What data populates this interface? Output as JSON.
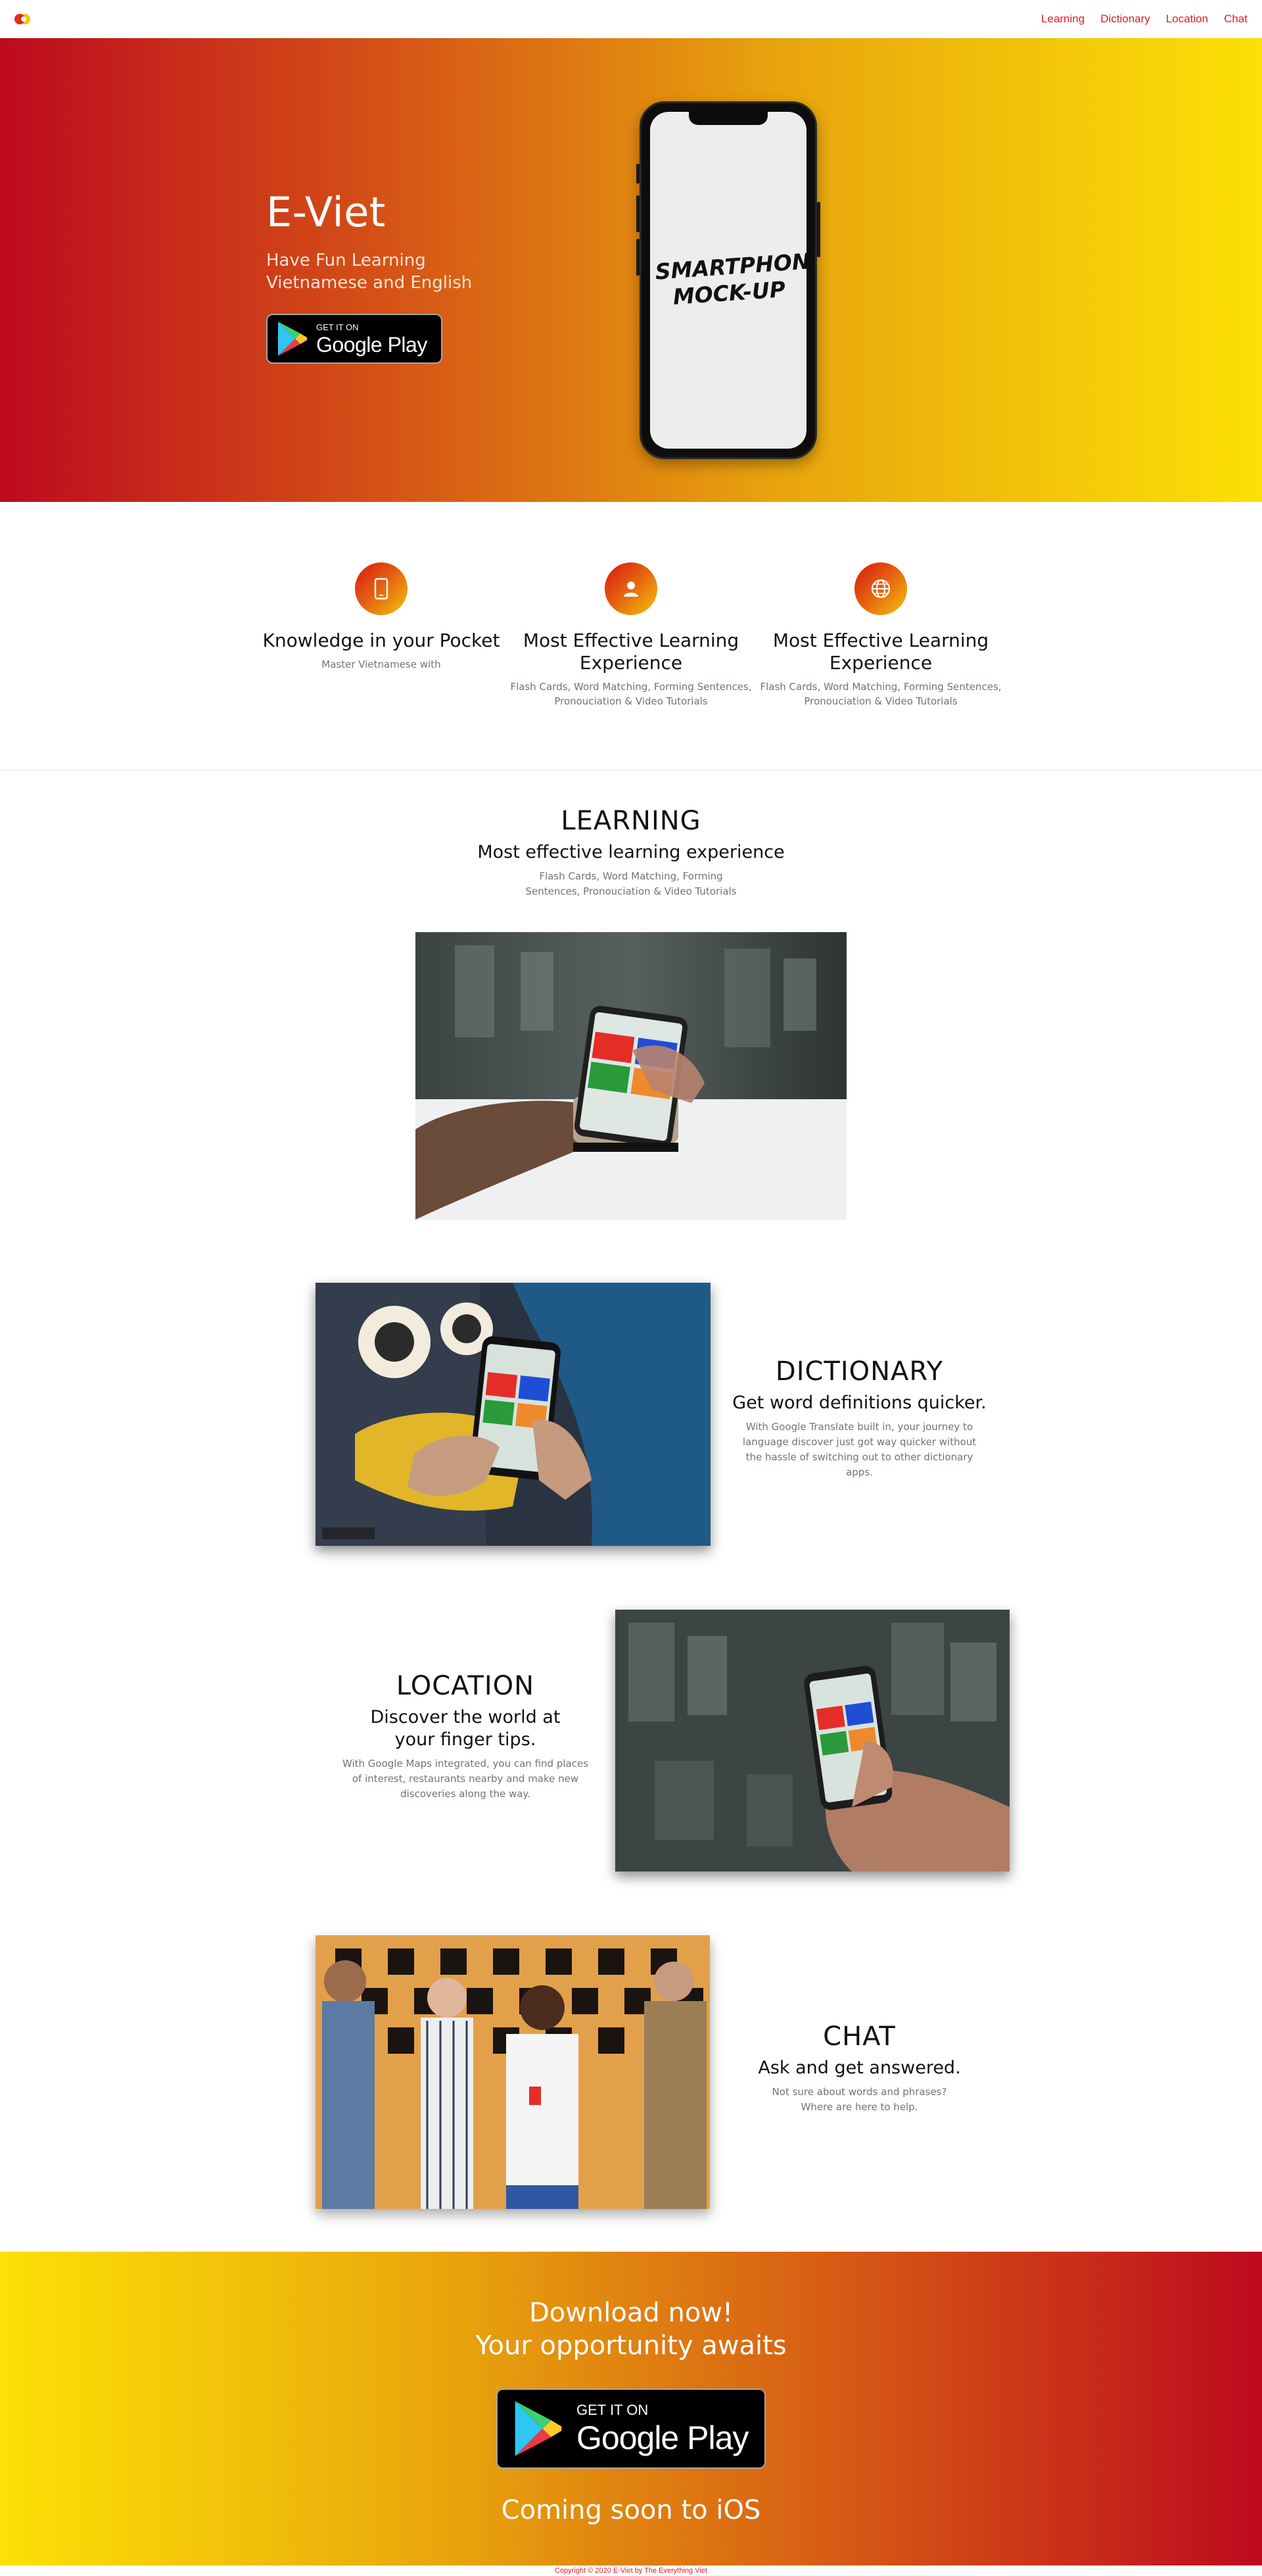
{
  "nav": {
    "links": [
      "Learning",
      "Dictionary",
      "Location",
      "Chat"
    ]
  },
  "hero": {
    "title": "E-Viet",
    "subtitle": "Have Fun Learning Vietnamese and English",
    "badge_line1": "GET IT ON",
    "badge_line2": "Google Play",
    "phone_text": "SMARTPHONE MOCK-UP"
  },
  "features": [
    {
      "icon": "smartphone-icon",
      "title": "Knowledge in your Pocket",
      "desc": "Master Vietnamese with"
    },
    {
      "icon": "person-icon",
      "title": "Most Effective Learning Experience",
      "desc": "Flash Cards, Word Matching, Forming Sentences, Pronouciation & Video Tutorials"
    },
    {
      "icon": "globe-icon",
      "title": "Most Effective Learning Experience",
      "desc": "Flash Cards, Word Matching, Forming Sentences, Pronouciation & Video Tutorials"
    }
  ],
  "learning": {
    "title": "LEARNING",
    "subtitle": "Most effective learning experience",
    "desc": "Flash Cards, Word Matching, Forming Sentences, Pronouciation & Video Tutorials"
  },
  "dictionary": {
    "title": "DICTIONARY",
    "subtitle": "Get word definitions quicker.",
    "desc": "With Google Translate built in, your journey to language discover just got way quicker without the hassle of switching out to other dictionary apps."
  },
  "location": {
    "title": "LOCATION",
    "subtitle": "Discover the world at your finger tips.",
    "desc": "With Google Maps integrated, you can find places of interest, restaurants nearby and make new discoveries along the way."
  },
  "chat": {
    "title": "CHAT",
    "subtitle": "Ask and get answered.",
    "desc": "Not sure about words and phrases? Where are here to help."
  },
  "cta": {
    "line1": "Download now!",
    "line2": "Your opportunity awaits",
    "badge_line1": "GET IT ON",
    "badge_line2": "Google Play",
    "ios": "Coming soon to iOS"
  },
  "footer": {
    "copyright": "Copyright © 2020 E-Viet by The Everything Viet"
  },
  "colors": {
    "accent": "#e31b23",
    "gradient_red": "#bd0a1e",
    "gradient_orange": "#d65616",
    "gradient_yellow": "#fce006"
  }
}
